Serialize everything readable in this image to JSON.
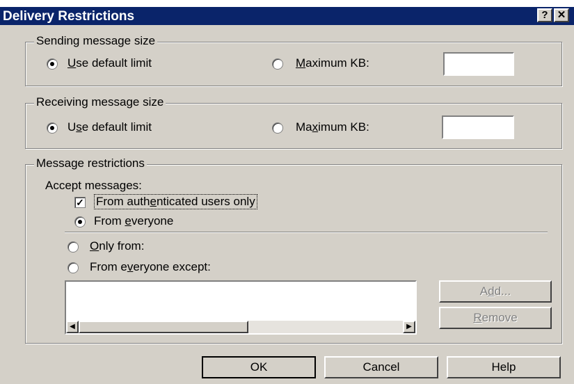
{
  "window": {
    "title": "Delivery Restrictions",
    "help_glyph": "?",
    "close_glyph": "✕"
  },
  "sending": {
    "legend": "Sending message size",
    "default_label_pre": "",
    "default_label_ul": "U",
    "default_label_post": "se default limit",
    "max_label_pre": "",
    "max_label_ul": "M",
    "max_label_post": "aximum KB:",
    "selected": "default",
    "max_value": ""
  },
  "receiving": {
    "legend": "Receiving message size",
    "default_label_pre": "U",
    "default_label_ul": "s",
    "default_label_post": "e default limit",
    "max_label_pre": "Ma",
    "max_label_ul": "x",
    "max_label_post": "imum KB:",
    "selected": "default",
    "max_value": ""
  },
  "restrictions": {
    "legend": "Message restrictions",
    "accept_label": "Accept messages:",
    "auth_pre": "From auth",
    "auth_ul": "e",
    "auth_post": "nticated users only",
    "auth_checked": true,
    "everyone_pre": "From ",
    "everyone_ul": "e",
    "everyone_post": "veryone",
    "only_pre": "",
    "only_ul": "O",
    "only_post": "nly from:",
    "except_pre": "From e",
    "except_ul": "v",
    "except_post": "eryone except:",
    "selected": "everyone",
    "list_items": []
  },
  "side_buttons": {
    "add_pre": "A",
    "add_ul": "d",
    "add_post": "d...",
    "remove_pre": "",
    "remove_ul": "R",
    "remove_post": "emove"
  },
  "footer": {
    "ok": "OK",
    "cancel": "Cancel",
    "help": "Help"
  },
  "colors": {
    "titlebar": "#0a246a",
    "face": "#d4d0c8"
  }
}
